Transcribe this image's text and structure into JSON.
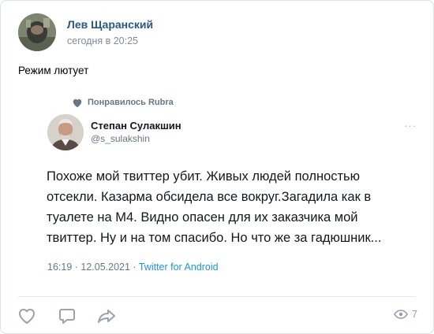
{
  "post": {
    "author": "Лев Щаранский",
    "time": "сегодня в 20:25",
    "text": "Режим лютует"
  },
  "tweet": {
    "liked_by": "Понравилось Rubra",
    "name": "Степан Сулакшин",
    "handle": "@s_sulakshin",
    "lines": [
      "Похоже мой твиттер убит. Живых людей полностью",
      "отсекли. Казарма обсидела все вокруг.Загадила как в",
      "туалете на М4.  Видно опасен для их заказчика мой",
      "твиттер. Ну и на том спасибо. Но что же за гадюшник..."
    ],
    "timestamp": "16:19 · 12.05.2021 · ",
    "source": "Twitter for Android",
    "more": "···"
  },
  "actions": {
    "views": "7",
    "icons": [
      "heart-icon",
      "comment-icon",
      "share-icon",
      "eye-icon"
    ]
  },
  "colors": {
    "link": "#2a5885",
    "meta": "#818c99",
    "twitter_blue": "#1b95e0",
    "icon": "#99a2ad"
  }
}
